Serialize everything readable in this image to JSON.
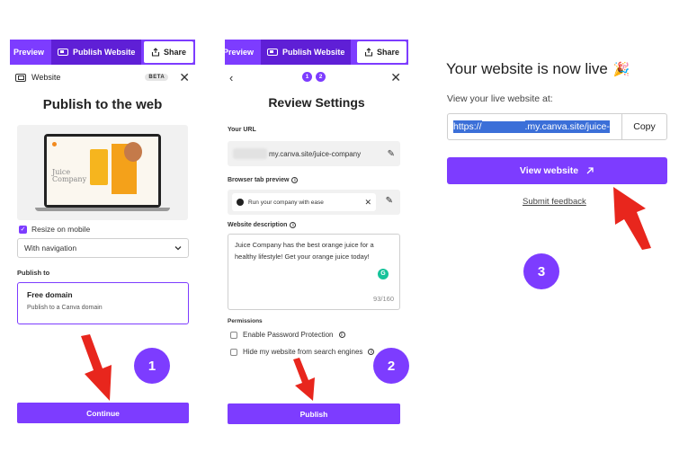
{
  "colors": {
    "accent": "#7d3cff",
    "accent_dark": "#5f1fd6",
    "arrow": "#e8261d"
  },
  "panel1": {
    "topbar": {
      "preview": "Preview",
      "publish_website": "Publish Website",
      "share": "Share"
    },
    "header": {
      "label": "Website",
      "badge": "BETA"
    },
    "title": "Publish to the web",
    "thumbnail_text": "Juice\nCompany",
    "resize_on_mobile": "Resize on mobile",
    "navigation_select": "With navigation",
    "publish_to_label": "Publish to",
    "domain_title": "Free domain",
    "domain_subtitle": "Publish to a Canva domain",
    "continue_button": "Continue",
    "step_badge": "1"
  },
  "panel2": {
    "topbar": {
      "preview": "Preview",
      "publish_website": "Publish Website",
      "share": "Share"
    },
    "steps": [
      "1",
      "2"
    ],
    "title": "Review Settings",
    "your_url_label": "Your URL",
    "url_value": "my.canva.site/juice-company",
    "browser_tab_label": "Browser tab preview",
    "tab_text": "Run your company with ease",
    "website_description_label": "Website description",
    "description": "Juice Company has the best orange juice for a healthy lifestyle! Get your orange juice today!",
    "char_count": "93/160",
    "permissions_label": "Permissions",
    "password_option": "Enable Password Protection",
    "search_option": "Hide my website from search engines",
    "publish_button": "Publish",
    "step_badge": "2"
  },
  "panel3": {
    "title": "Your website is now live",
    "subtitle": "View your live website at:",
    "url_start": "https://",
    "url_end": ".my.canva.site/juice-",
    "copy_button": "Copy",
    "view_button": "View website",
    "feedback_link": "Submit feedback",
    "step_badge": "3"
  }
}
